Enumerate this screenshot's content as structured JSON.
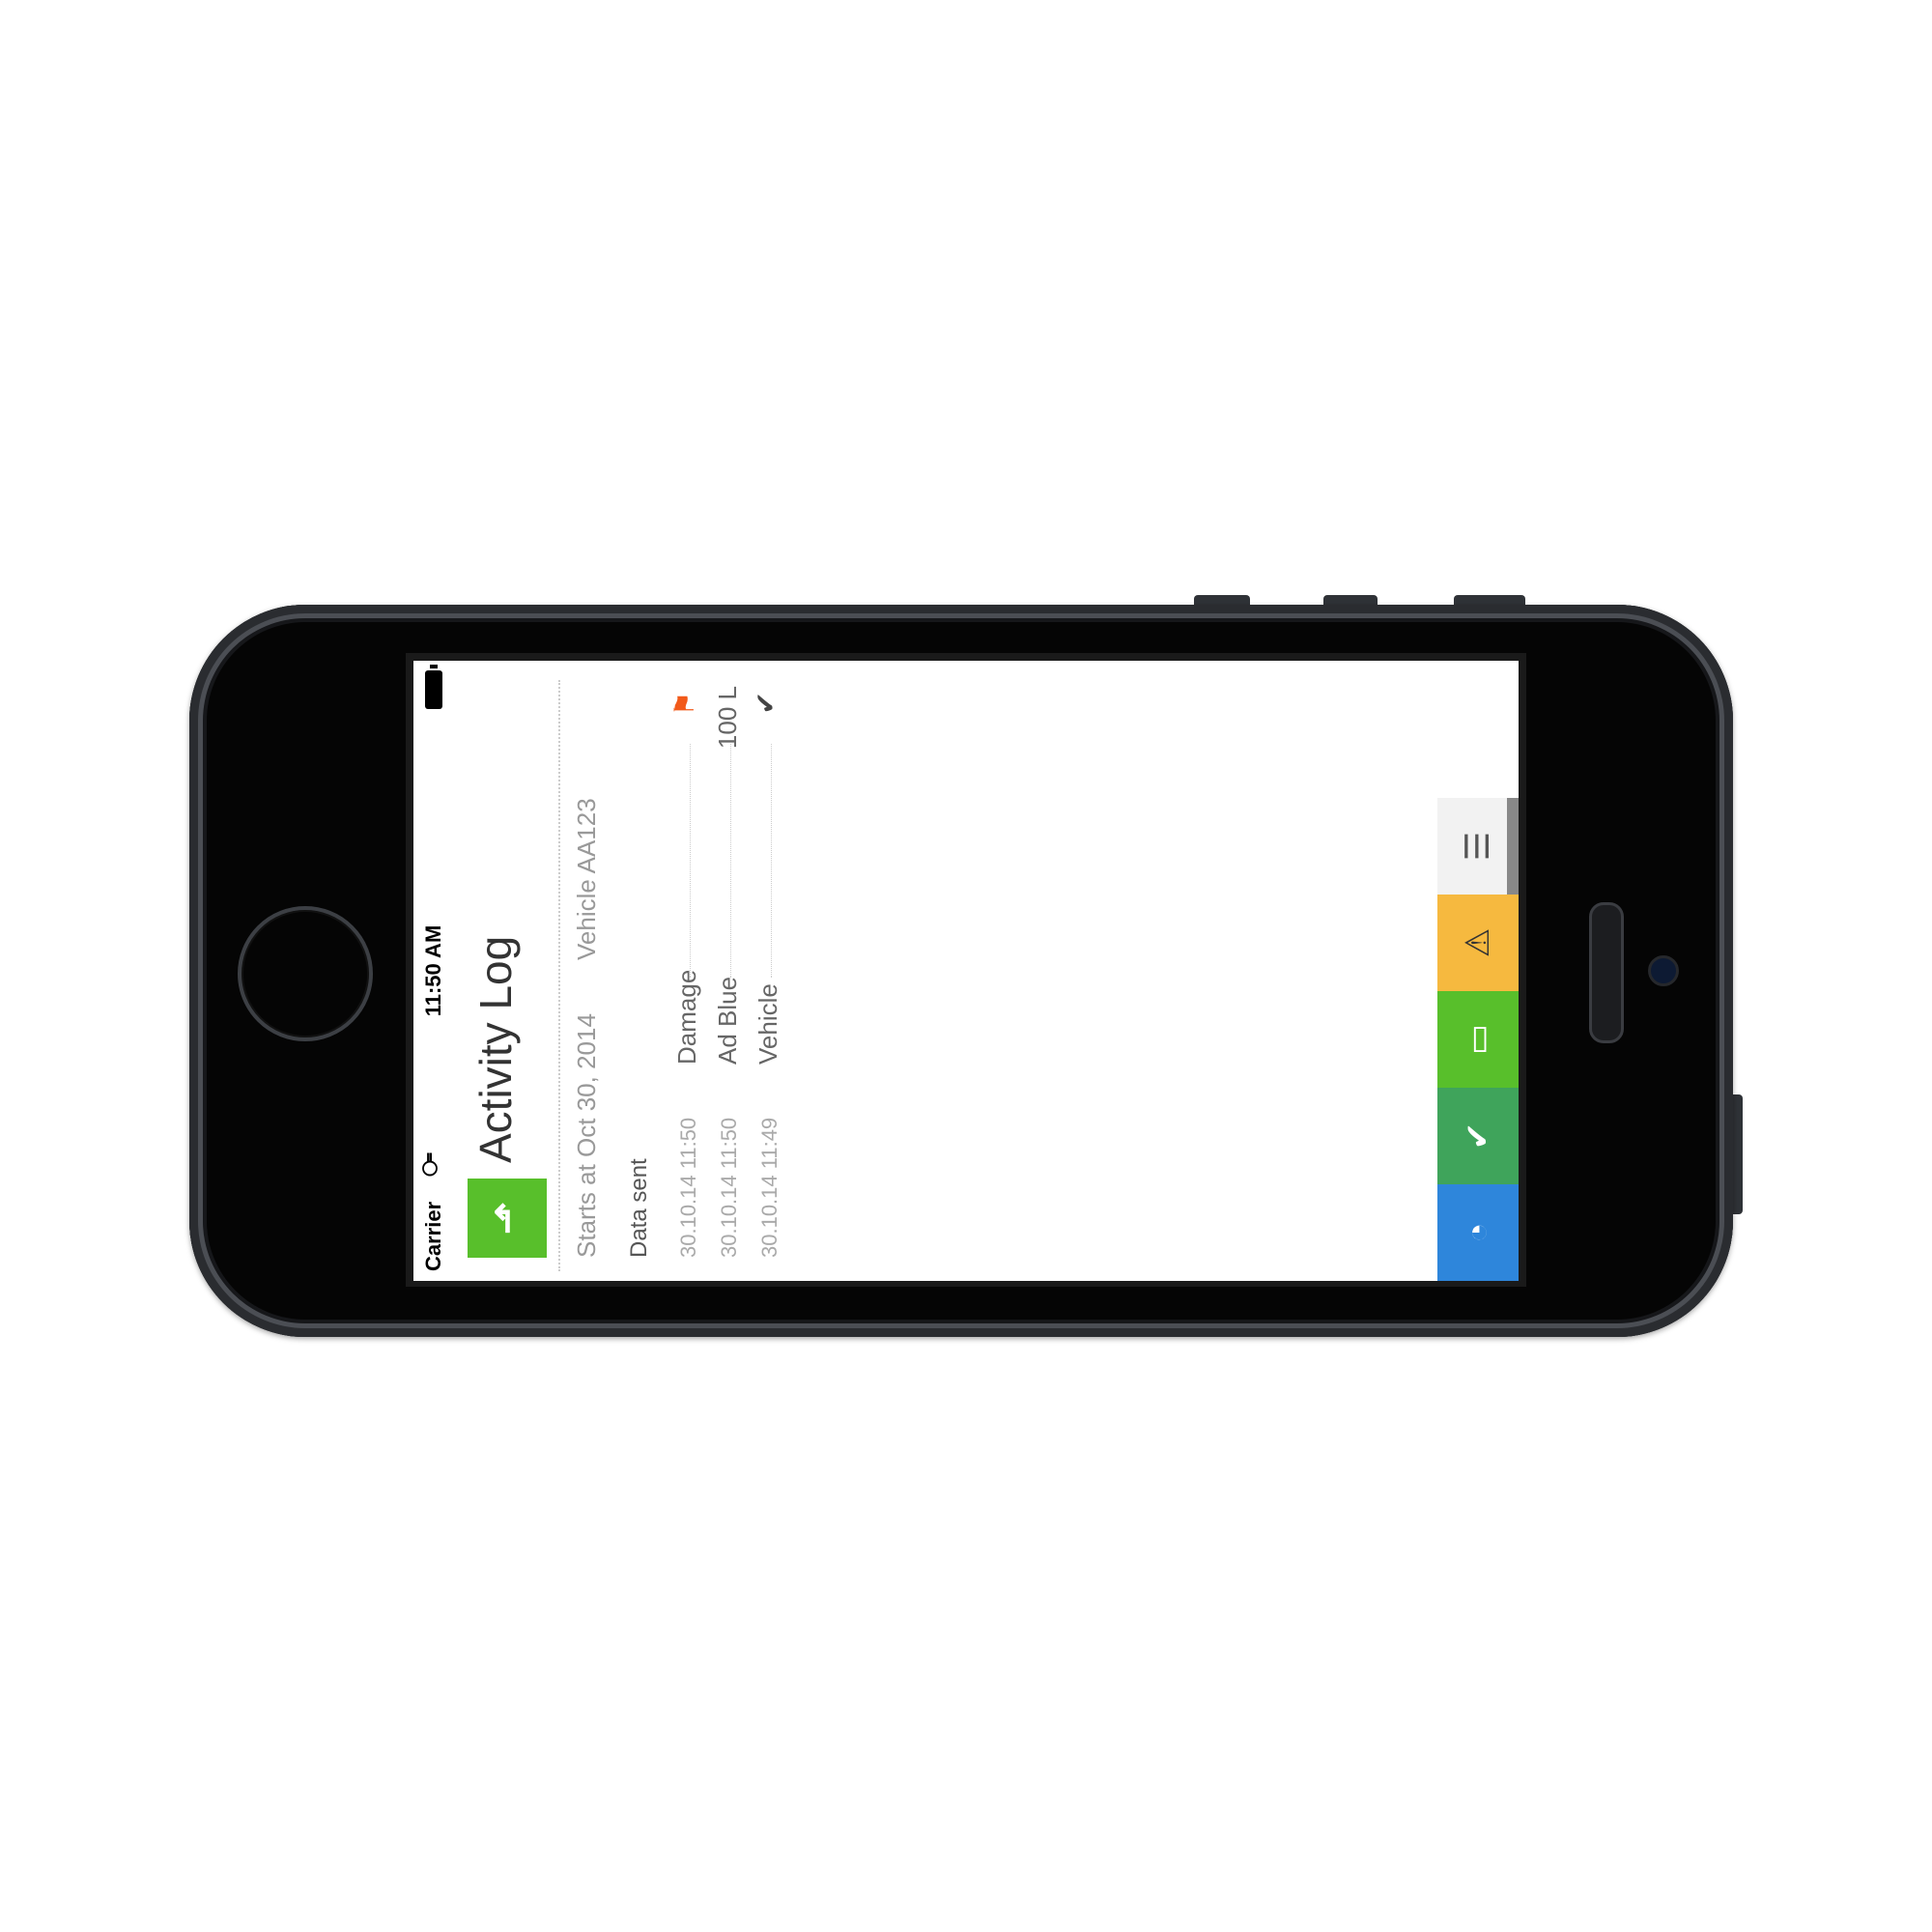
{
  "status_bar": {
    "carrier": "Carrier",
    "time": "11:50 AM"
  },
  "header": {
    "title": "Activity Log",
    "starts_at": "Starts at Oct 30, 2014",
    "vehicle": "Vehicle AA123"
  },
  "log": {
    "section_title": "Data sent",
    "entries": [
      {
        "time": "30.10.14 11:50",
        "label": "Damage",
        "value": "",
        "icon": "flag-icon",
        "icon_color": "#f25a1a"
      },
      {
        "time": "30.10.14 11:50",
        "label": "Ad Blue",
        "value": "100 L"
      },
      {
        "time": "30.10.14 11:49",
        "label": "Vehicle",
        "value": "",
        "icon": "check-icon"
      }
    ]
  },
  "bottom_nav": [
    {
      "icon": "speedometer-icon",
      "color": "#2e86db"
    },
    {
      "icon": "check-icon",
      "color": "#3fa45b"
    },
    {
      "icon": "fuel-card-icon",
      "color": "#58bf2b"
    },
    {
      "icon": "warning-icon",
      "color": "#f6b93f"
    },
    {
      "icon": "menu-icon",
      "color": "#f2f2f2"
    }
  ],
  "colors": {
    "header_badge": "#58bf2b"
  }
}
